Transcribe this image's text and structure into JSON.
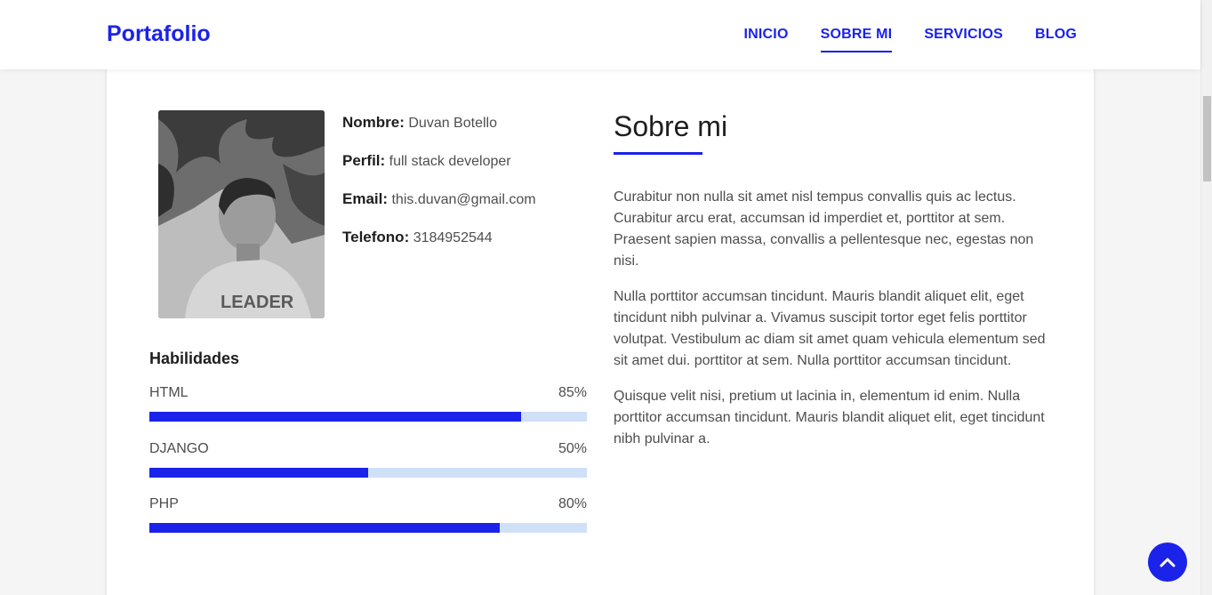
{
  "navbar": {
    "brand": "Portafolio",
    "items": [
      {
        "label": "INICIO",
        "active": false
      },
      {
        "label": "SOBRE MI",
        "active": true
      },
      {
        "label": "SERVICIOS",
        "active": false
      },
      {
        "label": "BLOG",
        "active": false
      }
    ]
  },
  "profile": {
    "fields": [
      {
        "label": "Nombre:",
        "value": "Duvan Botello"
      },
      {
        "label": "Perfil:",
        "value": "full stack developer"
      },
      {
        "label": "Email:",
        "value": "this.duvan@gmail.com"
      },
      {
        "label": "Telefono:",
        "value": "3184952544"
      }
    ]
  },
  "skills": {
    "title": "Habilidades",
    "items": [
      {
        "name": "HTML",
        "percent_label": "85%",
        "percent": 85
      },
      {
        "name": "DJANGO",
        "percent_label": "50%",
        "percent": 50
      },
      {
        "name": "PHP",
        "percent_label": "80%",
        "percent": 80
      }
    ]
  },
  "about": {
    "title": "Sobre mi",
    "paragraphs": [
      "Curabitur non nulla sit amet nisl tempus convallis quis ac lectus. Curabitur arcu erat, accumsan id imperdiet et, porttitor at sem. Praesent sapien massa, convallis a pellentesque nec, egestas non nisi.",
      "Nulla porttitor accumsan tincidunt. Mauris blandit aliquet elit, eget tincidunt nibh pulvinar a. Vivamus suscipit tortor eget felis porttitor volutpat. Vestibulum ac diam sit amet quam vehicula elementum sed sit amet dui. porttitor at sem. Nulla porttitor accumsan tincidunt.",
      "Quisque velit nisi, pretium ut lacinia in, elementum id enim. Nulla porttitor accumsan tincidunt. Mauris blandit aliquet elit, eget tincidunt nibh pulvinar a."
    ]
  },
  "colors": {
    "accent": "#1b22ea",
    "bar_track": "#cfe0f7"
  },
  "icons": {
    "back_to_top": "chevron-up-icon"
  }
}
